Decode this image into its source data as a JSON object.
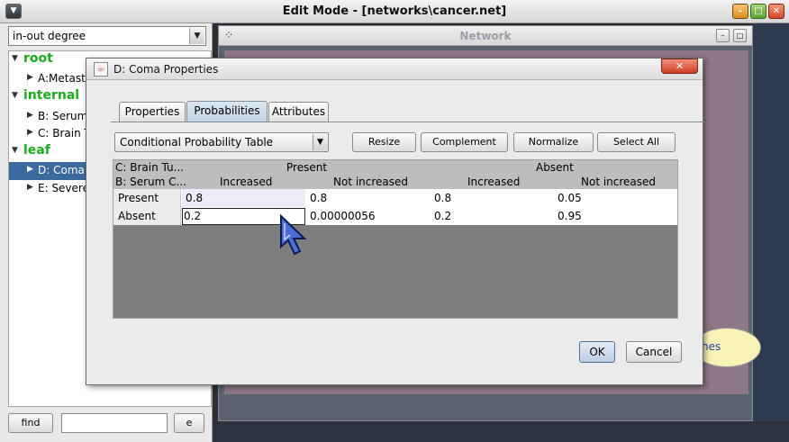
{
  "window": {
    "title": "Edit Mode - [networks\\cancer.net]",
    "min_glyph": "–",
    "max_glyph": "□",
    "close_glyph": "✕"
  },
  "left": {
    "selector_value": "in-out degree",
    "tree": {
      "root": {
        "label": "root",
        "items": [
          "A:Metasta"
        ]
      },
      "internal": {
        "label": "internal",
        "items": [
          "B: Serum",
          "C:  Brain T"
        ]
      },
      "leaf": {
        "label": "leaf",
        "items": [
          "D: Coma",
          "E: Severe"
        ]
      }
    },
    "find_label": "find",
    "find_input_value": "",
    "e_label": "e"
  },
  "network": {
    "title": "Network",
    "node_text": "hes"
  },
  "dialog": {
    "title": "D: Coma Properties",
    "close_glyph": "✕",
    "tabs": [
      "Properties",
      "Probabilities",
      "Attributes"
    ],
    "active_tab": "Probabilities",
    "table_mode": "Conditional Probability Table",
    "buttons": {
      "resize": "Resize",
      "complement": "Complement",
      "normalize": "Normalize",
      "select_all": "Select All"
    },
    "ok": "OK",
    "cancel": "Cancel",
    "cpt": {
      "parent1_label": "C:  Brain Tu...",
      "parent2_label": "B: Serum C...",
      "parent1_states": [
        "Present",
        "Absent"
      ],
      "parent2_states": [
        "Increased",
        "Not increased",
        "Increased",
        "Not increased"
      ],
      "rows": [
        {
          "state": "Present",
          "values": [
            "0.8",
            "0.8",
            "0.8",
            "0.05"
          ]
        },
        {
          "state": "Absent",
          "values": [
            "0.2",
            "0.00000056",
            "0.2",
            "0.95"
          ]
        }
      ]
    }
  },
  "colors": {
    "tree_heading": "#1aab1a",
    "selection": "#3d6a9e",
    "canvas": "#8e7787",
    "active_tab": "#c3d4e6"
  }
}
